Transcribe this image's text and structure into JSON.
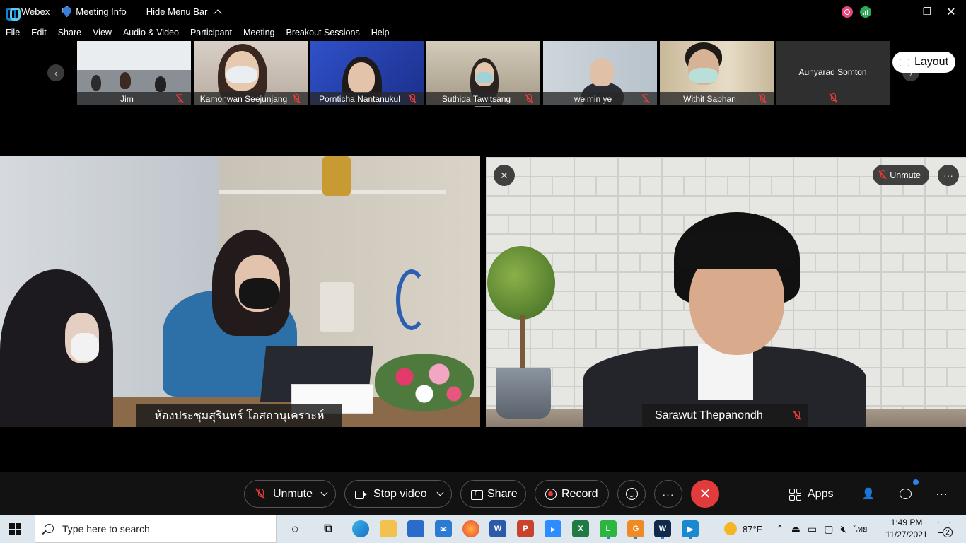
{
  "titlebar": {
    "app_name": "Webex",
    "meeting_info": "Meeting Info",
    "hide_menu_bar": "Hide Menu Bar",
    "minimize": "—",
    "restore": "❐",
    "close": "✕"
  },
  "menu": [
    "File",
    "Edit",
    "Share",
    "View",
    "Audio & Video",
    "Participant",
    "Meeting",
    "Breakout Sessions",
    "Help"
  ],
  "layout_button": "Layout",
  "filmstrip": [
    {
      "name": "Jim"
    },
    {
      "name": "Kamonwan Seejunjang"
    },
    {
      "name": "Pornticha Nantanukul"
    },
    {
      "name": "Suthida Tawitsang"
    },
    {
      "name": "weimin ye"
    },
    {
      "name": "Withit Saphan"
    },
    {
      "name": "Aunyarad Somton"
    }
  ],
  "main_left": {
    "name": "ห้องประชุมสุรินทร์ โอสถานุเคราะห์"
  },
  "main_right": {
    "name": "Sarawut Thepanondh",
    "unmute_label": "Unmute",
    "more": "···"
  },
  "controls": {
    "unmute": "Unmute",
    "stop_video": "Stop video",
    "share": "Share",
    "record": "Record",
    "more": "···",
    "leave": "✕",
    "apps": "Apps",
    "more_right": "···"
  },
  "taskbar": {
    "search_placeholder": "Type here to search",
    "weather": "87°F",
    "language": "ไทย",
    "time": "1:49 PM",
    "date": "11/27/2021",
    "notifications": "2"
  },
  "colors": {
    "leave_red": "#e23b3b",
    "muted_red": "#e23b3b",
    "chat_badge_blue": "#2e84e8"
  }
}
